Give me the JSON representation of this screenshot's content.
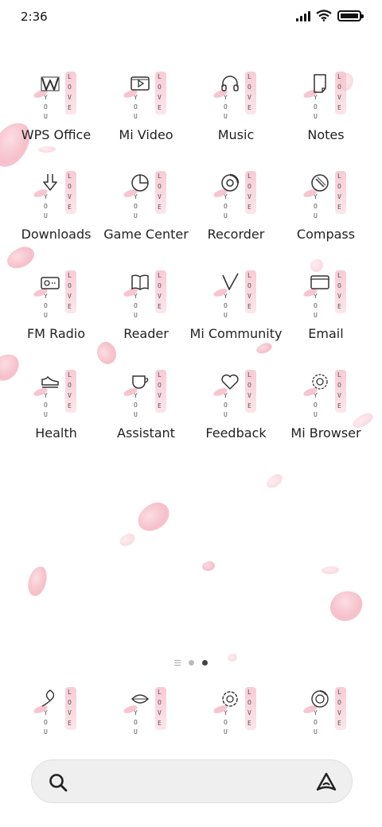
{
  "status_bar": {
    "time": "2:36",
    "icons": [
      "cellular-signal-icon",
      "wifi-icon",
      "battery-icon"
    ],
    "battery_level": 1.0
  },
  "love_letters": [
    "L",
    "O",
    "V",
    "E"
  ],
  "you_letters": [
    "Y",
    "O",
    "U"
  ],
  "apps": [
    {
      "label": "WPS Office",
      "icon": "wps-office-icon"
    },
    {
      "label": "Mi Video",
      "icon": "video-player-icon"
    },
    {
      "label": "Music",
      "icon": "headphones-icon"
    },
    {
      "label": "Notes",
      "icon": "notes-icon"
    },
    {
      "label": "Downloads",
      "icon": "download-arrow-icon"
    },
    {
      "label": "Game Center",
      "icon": "pie-chart-icon"
    },
    {
      "label": "Recorder",
      "icon": "recorder-icon"
    },
    {
      "label": "Compass",
      "icon": "compass-icon"
    },
    {
      "label": "FM Radio",
      "icon": "radio-icon"
    },
    {
      "label": "Reader",
      "icon": "open-book-icon"
    },
    {
      "label": "Mi Community",
      "icon": "check-mark-icon"
    },
    {
      "label": "Email",
      "icon": "envelope-icon"
    },
    {
      "label": "Health",
      "icon": "sneaker-icon"
    },
    {
      "label": "Assistant",
      "icon": "cup-icon"
    },
    {
      "label": "Feedback",
      "icon": "heart-icon"
    },
    {
      "label": "Mi Browser",
      "icon": "flower-outline-icon"
    }
  ],
  "dock": [
    {
      "icon": "leaf-icon"
    },
    {
      "icon": "chat-bubble-leaf-icon"
    },
    {
      "icon": "flower-icon"
    },
    {
      "icon": "camera-lens-icon"
    }
  ],
  "page_indicator": {
    "pages": 2,
    "current": 2
  },
  "search_bar": {
    "left_icon": "search-icon",
    "right_icon": "assistant-triangle-icon"
  },
  "colors": {
    "petal": "#f4b4c1",
    "strip": "#f6bac7",
    "text": "#222222",
    "search_bg": "#efefef"
  }
}
